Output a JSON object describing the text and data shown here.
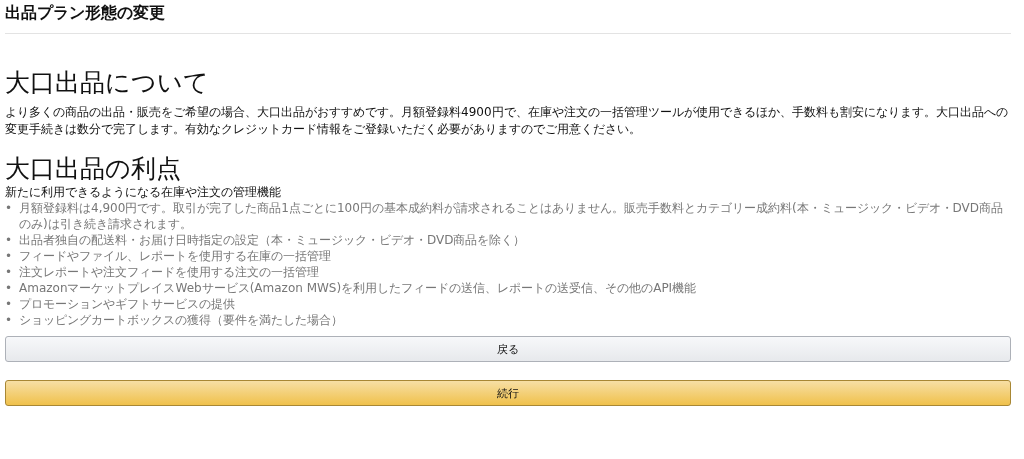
{
  "page_title": "出品プラン形態の変更",
  "sections": [
    {
      "heading": "大口出品について",
      "paragraph": "より多くの商品の出品・販売をご希望の場合、大口出品がおすすめです。月額登録料4900円で、在庫や注文の一括管理ツールが使用できるほか、手数料も割安になります。大口出品への変更手続きは数分で完了します。有効なクレジットカード情報をご登録いただく必要がありますのでご用意ください。"
    },
    {
      "heading": "大口出品の利点",
      "subtitle": "新たに利用できるようになる在庫や注文の管理機能",
      "bullet": "•",
      "items": [
        "月額登録料は4,900円です。取引が完了した商品1点ごとに100円の基本成約料が請求されることはありません。販売手数料とカテゴリー成約料(本・ミュージック・ビデオ・DVD商品のみ)は引き続き請求されます。",
        "出品者独自の配送料・お届け日時指定の設定（本・ミュージック・ビデオ・DVD商品を除く）",
        "フィードやファイル、レポートを使用する在庫の一括管理",
        "注文レポートや注文フィードを使用する注文の一括管理",
        "AmazonマーケットプレイスWebサービス(Amazon MWS)を利用したフィードの送信、レポートの送受信、その他のAPI機能",
        "プロモーションやギフトサービスの提供",
        "ショッピングカートボックスの獲得（要件を満たした場合）"
      ]
    }
  ],
  "buttons": [
    {
      "label": "戻る",
      "kind": "secondary"
    },
    {
      "label": "続行",
      "kind": "primary"
    }
  ]
}
